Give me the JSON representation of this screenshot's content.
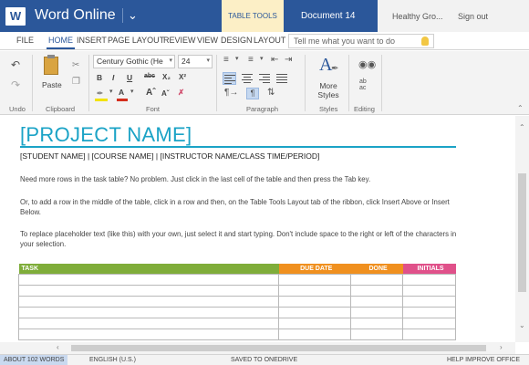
{
  "app": {
    "name": "Word Online",
    "icon": "word-icon",
    "accent": "#2b579a"
  },
  "titlebar": {
    "table_tools": "TABLE TOOLS",
    "document_name": "Document 14",
    "user": "Healthy Gro...",
    "sign_out": "Sign out"
  },
  "tabs": [
    "FILE",
    "HOME",
    "INSERT",
    "PAGE LAYOUT",
    "REVIEW",
    "VIEW",
    "DESIGN",
    "LAYOUT"
  ],
  "active_tab": "HOME",
  "tell_me": {
    "placeholder": "Tell me what you want to do"
  },
  "ribbon": {
    "groups": [
      "Undo",
      "Clipboard",
      "Font",
      "Paragraph",
      "Styles",
      "Editing"
    ],
    "paste_label": "Paste",
    "font_name": "Century Gothic (He",
    "font_size": "24",
    "styles_label": "More Styles"
  },
  "document": {
    "title": "[PROJECT NAME]",
    "subheading": "[STUDENT NAME]  |  [COURSE NAME]  |  [INSTRUCTOR NAME/CLASS TIME/PERIOD]",
    "paragraphs": [
      "Need more rows in the task table? No problem. Just click in the last cell of the table and then press the Tab key.",
      "Or, to add a row in the middle of the table, click in a row and then, on the Table Tools Layout tab of the ribbon, click Insert Above or Insert Below.",
      "To replace placeholder text (like this) with your own, just select it and start typing. Don't include space to the right or left of the characters in your selection."
    ],
    "title_color": "#1ba3c6",
    "table": {
      "columns": [
        "TASK",
        "DUE DATE",
        "DONE",
        "INITIALS"
      ],
      "column_colors": [
        "#7fad3a",
        "#f0901f",
        "#f0901f",
        "#e0518a"
      ]
    }
  },
  "statusbar": {
    "word_count": "ABOUT 102 WORDS",
    "language": "ENGLISH (U.S.)",
    "save_status": "SAVED TO ONEDRIVE",
    "help": "HELP IMPROVE OFFICE"
  }
}
